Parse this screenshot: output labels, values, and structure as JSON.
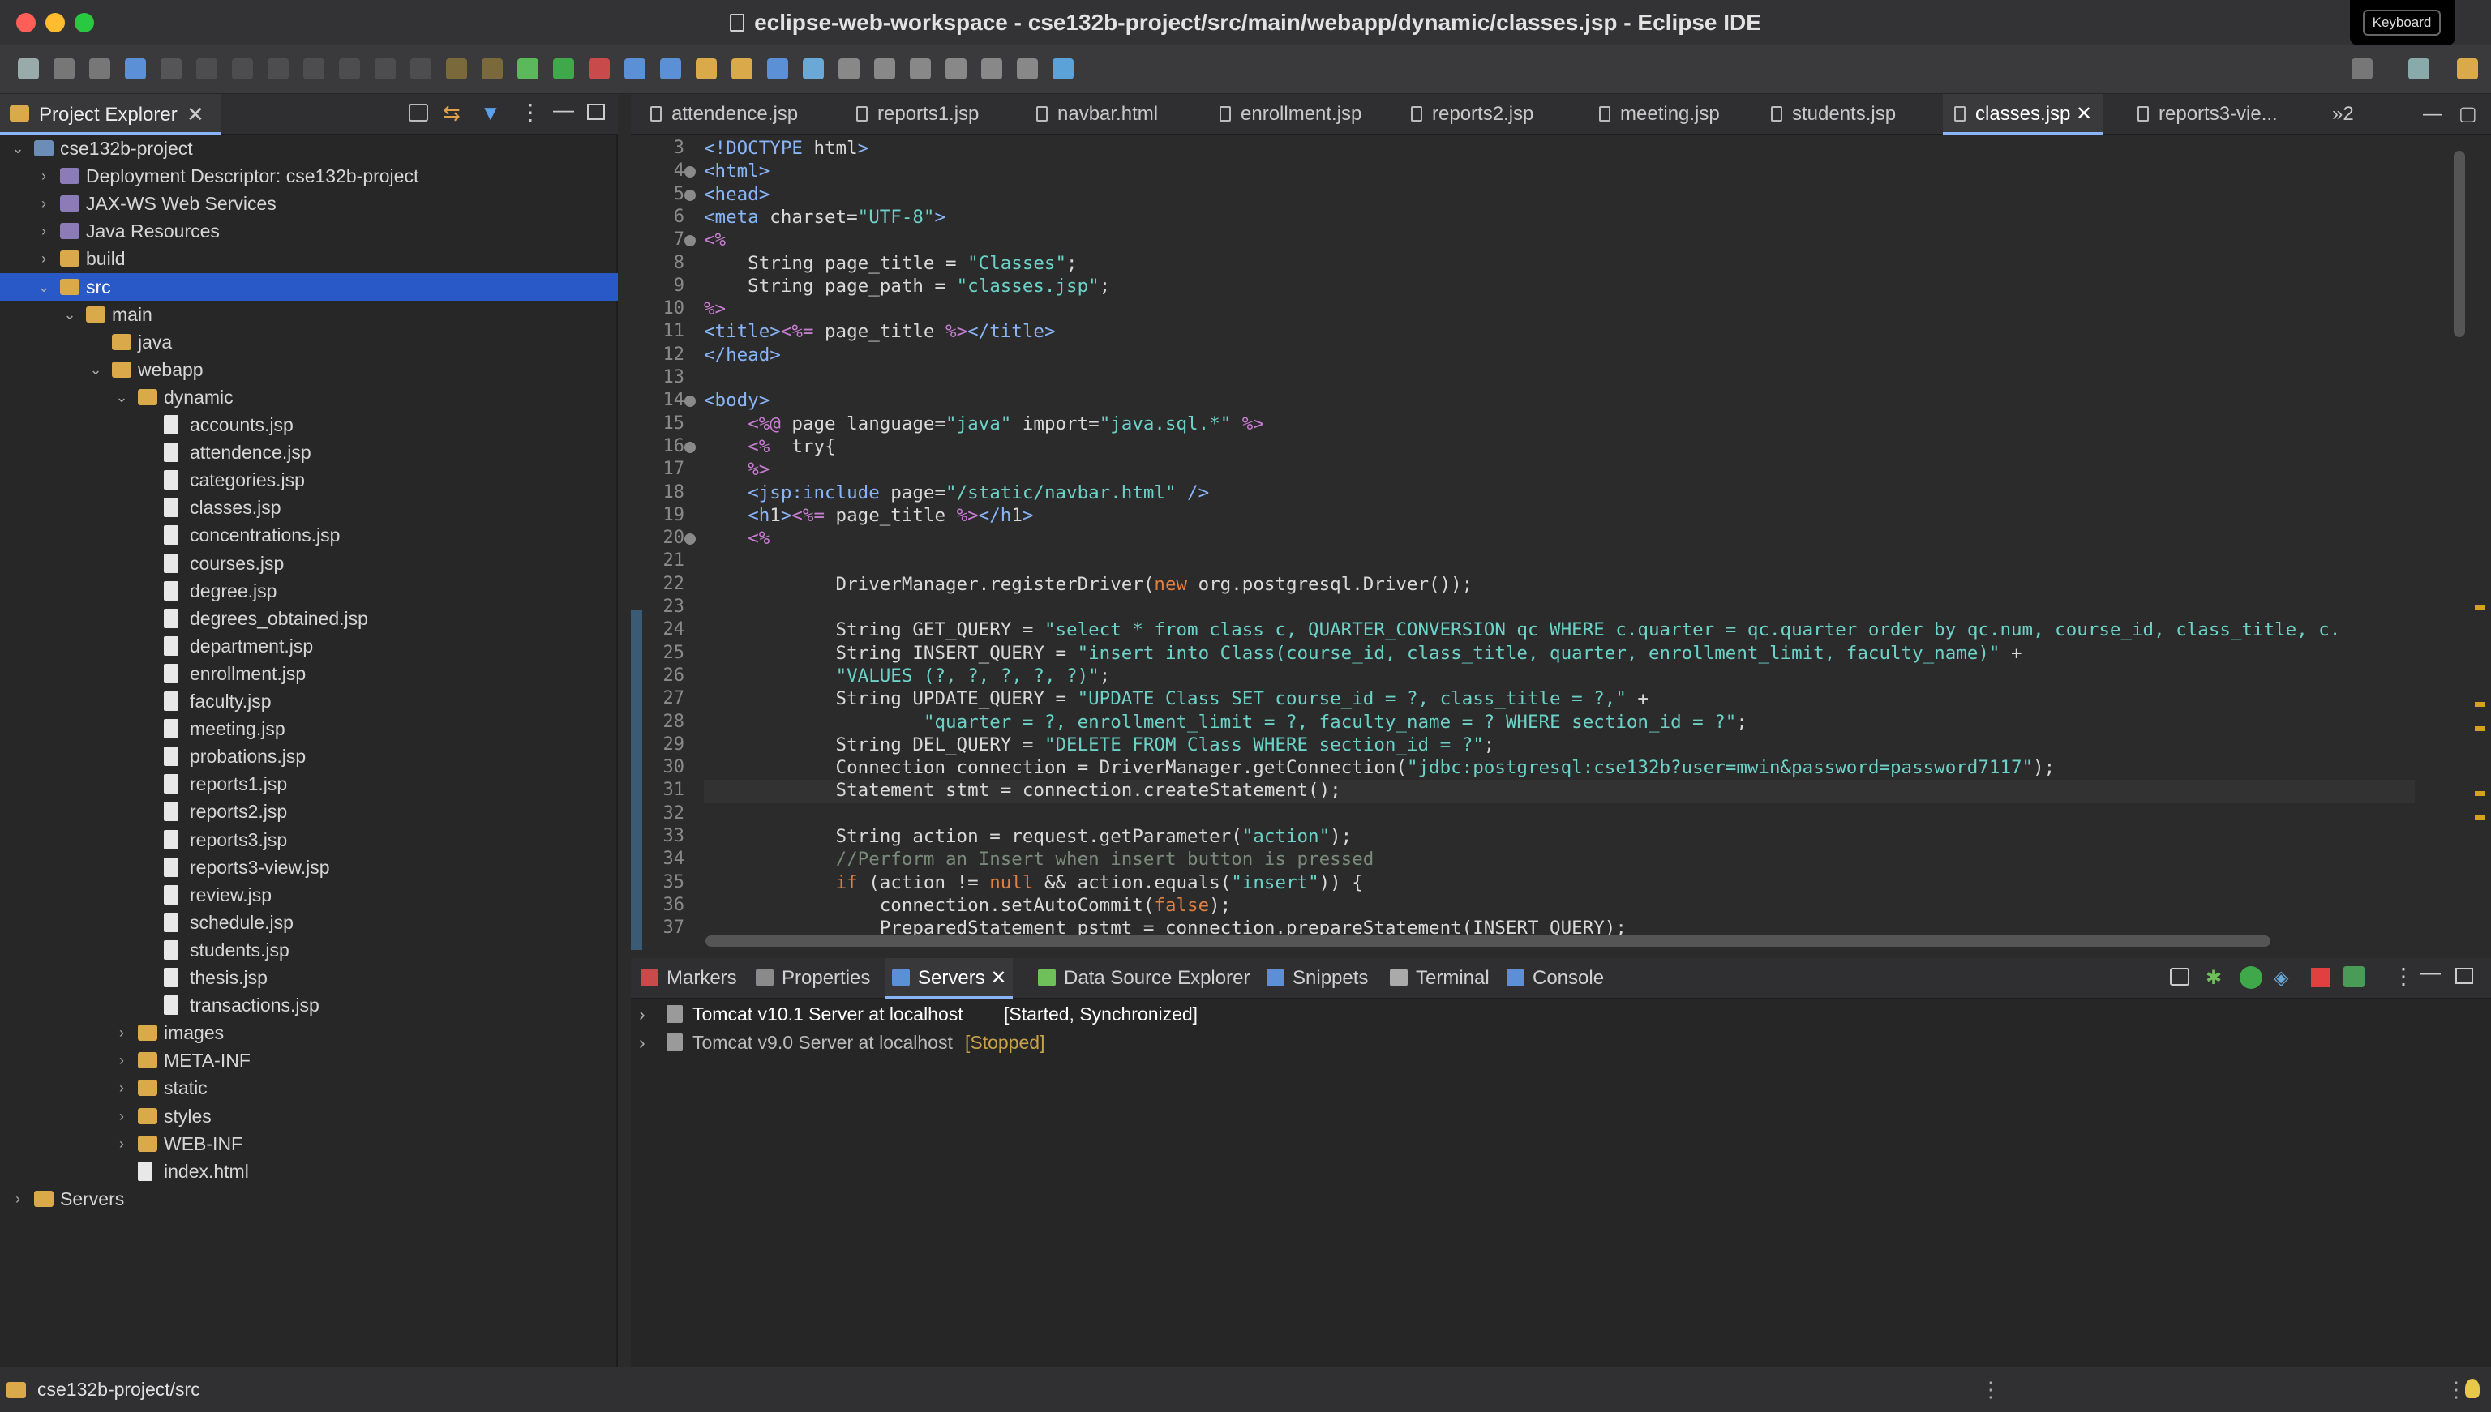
{
  "window": {
    "title": "eclipse-web-workspace - cse132b-project/src/main/webapp/dynamic/classes.jsp - Eclipse IDE",
    "keyboard_overlay": "Keyboard"
  },
  "project_explorer": {
    "tab_label": "Project Explorer",
    "tree": [
      {
        "label": "cse132b-project",
        "indent": 0,
        "expanded": true,
        "icon": "project-icon"
      },
      {
        "label": "Deployment Descriptor: cse132b-project",
        "indent": 1,
        "expanded": false,
        "icon": "descriptor-icon"
      },
      {
        "label": "JAX-WS Web Services",
        "indent": 1,
        "expanded": false,
        "icon": "webservice-icon"
      },
      {
        "label": "Java Resources",
        "indent": 1,
        "expanded": false,
        "icon": "java-resources-icon"
      },
      {
        "label": "build",
        "indent": 1,
        "expanded": false,
        "icon": "folder-icon"
      },
      {
        "label": "src",
        "indent": 1,
        "expanded": true,
        "icon": "folder-icon",
        "selected": true
      },
      {
        "label": "main",
        "indent": 2,
        "expanded": true,
        "icon": "folder-icon"
      },
      {
        "label": "java",
        "indent": 3,
        "icon": "folder-icon"
      },
      {
        "label": "webapp",
        "indent": 3,
        "expanded": true,
        "icon": "folder-icon"
      },
      {
        "label": "dynamic",
        "indent": 4,
        "expanded": true,
        "icon": "folder-icon"
      },
      {
        "label": "accounts.jsp",
        "indent": 5,
        "icon": "file-icon"
      },
      {
        "label": "attendence.jsp",
        "indent": 5,
        "icon": "file-icon"
      },
      {
        "label": "categories.jsp",
        "indent": 5,
        "icon": "file-icon"
      },
      {
        "label": "classes.jsp",
        "indent": 5,
        "icon": "file-icon"
      },
      {
        "label": "concentrations.jsp",
        "indent": 5,
        "icon": "file-icon"
      },
      {
        "label": "courses.jsp",
        "indent": 5,
        "icon": "file-icon"
      },
      {
        "label": "degree.jsp",
        "indent": 5,
        "icon": "file-icon"
      },
      {
        "label": "degrees_obtained.jsp",
        "indent": 5,
        "icon": "file-icon"
      },
      {
        "label": "department.jsp",
        "indent": 5,
        "icon": "file-icon"
      },
      {
        "label": "enrollment.jsp",
        "indent": 5,
        "icon": "file-icon"
      },
      {
        "label": "faculty.jsp",
        "indent": 5,
        "icon": "file-icon"
      },
      {
        "label": "meeting.jsp",
        "indent": 5,
        "icon": "file-icon"
      },
      {
        "label": "probations.jsp",
        "indent": 5,
        "icon": "file-icon"
      },
      {
        "label": "reports1.jsp",
        "indent": 5,
        "icon": "file-icon"
      },
      {
        "label": "reports2.jsp",
        "indent": 5,
        "icon": "file-icon"
      },
      {
        "label": "reports3.jsp",
        "indent": 5,
        "icon": "file-icon"
      },
      {
        "label": "reports3-view.jsp",
        "indent": 5,
        "icon": "file-icon"
      },
      {
        "label": "review.jsp",
        "indent": 5,
        "icon": "file-icon"
      },
      {
        "label": "schedule.jsp",
        "indent": 5,
        "icon": "file-icon"
      },
      {
        "label": "students.jsp",
        "indent": 5,
        "icon": "file-icon"
      },
      {
        "label": "thesis.jsp",
        "indent": 5,
        "icon": "file-icon"
      },
      {
        "label": "transactions.jsp",
        "indent": 5,
        "icon": "file-icon"
      },
      {
        "label": "images",
        "indent": 4,
        "expanded": false,
        "icon": "folder-icon"
      },
      {
        "label": "META-INF",
        "indent": 4,
        "expanded": false,
        "icon": "folder-icon"
      },
      {
        "label": "static",
        "indent": 4,
        "expanded": false,
        "icon": "folder-icon"
      },
      {
        "label": "styles",
        "indent": 4,
        "expanded": false,
        "icon": "folder-icon"
      },
      {
        "label": "WEB-INF",
        "indent": 4,
        "expanded": false,
        "icon": "folder-icon"
      },
      {
        "label": "index.html",
        "indent": 4,
        "icon": "file-icon"
      },
      {
        "label": "Servers",
        "indent": 0,
        "expanded": false,
        "icon": "folder-icon"
      }
    ]
  },
  "editor": {
    "tabs": [
      {
        "label": "attendence.jsp"
      },
      {
        "label": "reports1.jsp"
      },
      {
        "label": "navbar.html"
      },
      {
        "label": "enrollment.jsp"
      },
      {
        "label": "reports2.jsp"
      },
      {
        "label": "meeting.jsp"
      },
      {
        "label": "students.jsp"
      },
      {
        "label": "classes.jsp",
        "active": true
      },
      {
        "label": "reports3-vie..."
      }
    ],
    "overflow_label": "»2",
    "lines": [
      {
        "n": "3",
        "text": "<!DOCTYPE html>"
      },
      {
        "n": "4",
        "text": "<html>",
        "fold": true
      },
      {
        "n": "5",
        "text": "<head>",
        "fold": true
      },
      {
        "n": "6",
        "text": "<meta charset=\"UTF-8\">"
      },
      {
        "n": "7",
        "text": "<%",
        "fold": true
      },
      {
        "n": "8",
        "text": "    String page_title = \"Classes\";"
      },
      {
        "n": "9",
        "text": "    String page_path = \"classes.jsp\";"
      },
      {
        "n": "10",
        "text": "%>"
      },
      {
        "n": "11",
        "text": "<title><%= page_title %></title>"
      },
      {
        "n": "12",
        "text": "</head>"
      },
      {
        "n": "13",
        "text": ""
      },
      {
        "n": "14",
        "text": "<body>",
        "fold": true
      },
      {
        "n": "15",
        "text": "    <%@ page language=\"java\" import=\"java.sql.*\" %>"
      },
      {
        "n": "16",
        "text": "    <%  try{",
        "fold": true
      },
      {
        "n": "17",
        "text": "    %>"
      },
      {
        "n": "18",
        "text": "    <jsp:include page=\"/static/navbar.html\" />"
      },
      {
        "n": "19",
        "text": "    <h1><%= page_title %></h1>"
      },
      {
        "n": "20",
        "text": "    <%",
        "fold": true
      },
      {
        "n": "21",
        "text": ""
      },
      {
        "n": "22",
        "text": "            DriverManager.registerDriver(new org.postgresql.Driver());"
      },
      {
        "n": "23",
        "text": ""
      },
      {
        "n": "24",
        "text": "            String GET_QUERY = \"select * from class c, QUARTER_CONVERSION qc WHERE c.quarter = qc.quarter order by qc.num, course_id, class_title, c."
      },
      {
        "n": "25",
        "text": "            String INSERT_QUERY = \"insert into Class(course_id, class_title, quarter, enrollment_limit, faculty_name)\" +"
      },
      {
        "n": "26",
        "text": "            \"VALUES (?, ?, ?, ?, ?)\";"
      },
      {
        "n": "27",
        "text": "            String UPDATE_QUERY = \"UPDATE Class SET course_id = ?, class_title = ?,\" +"
      },
      {
        "n": "28",
        "text": "                    \"quarter = ?, enrollment_limit = ?, faculty_name = ? WHERE section_id = ?\";"
      },
      {
        "n": "29",
        "text": "            String DEL_QUERY = \"DELETE FROM Class WHERE section_id = ?\";"
      },
      {
        "n": "30",
        "text": "            Connection connection = DriverManager.getConnection(\"jdbc:postgresql:cse132b?user=mwin&password=password7117\");"
      },
      {
        "n": "31",
        "text": "            Statement stmt = connection.createStatement();",
        "current": true
      },
      {
        "n": "32",
        "text": ""
      },
      {
        "n": "33",
        "text": "            String action = request.getParameter(\"action\");"
      },
      {
        "n": "34",
        "text": "            //Perform an Insert when insert button is pressed"
      },
      {
        "n": "35",
        "text": "            if (action != null && action.equals(\"insert\")) {"
      },
      {
        "n": "36",
        "text": "                connection.setAutoCommit(false);"
      },
      {
        "n": "37",
        "text": "                PreparedStatement pstmt = connection.prepareStatement(INSERT_QUERY);"
      }
    ]
  },
  "bottom_panel": {
    "tabs": [
      {
        "label": "Markers",
        "icon": "markers-icon"
      },
      {
        "label": "Properties",
        "icon": "properties-icon"
      },
      {
        "label": "Servers",
        "icon": "servers-icon",
        "active": true
      },
      {
        "label": "Data Source Explorer",
        "icon": "datasource-icon"
      },
      {
        "label": "Snippets",
        "icon": "snippets-icon"
      },
      {
        "label": "Terminal",
        "icon": "terminal-icon"
      },
      {
        "label": "Console",
        "icon": "console-icon"
      }
    ],
    "servers": [
      {
        "name": "Tomcat v10.1 Server at localhost",
        "state": "[Started, Synchronized]"
      },
      {
        "name": "Tomcat v9.0 Server at localhost",
        "state": "[Stopped]"
      }
    ]
  },
  "status_bar": {
    "path": "cse132b-project/src"
  },
  "colors": {
    "accent": "#2959c6",
    "active_tab_underline": "#8ab4f8",
    "close": "#ff5f57",
    "minimize": "#febc2e",
    "maximize": "#28c840"
  }
}
